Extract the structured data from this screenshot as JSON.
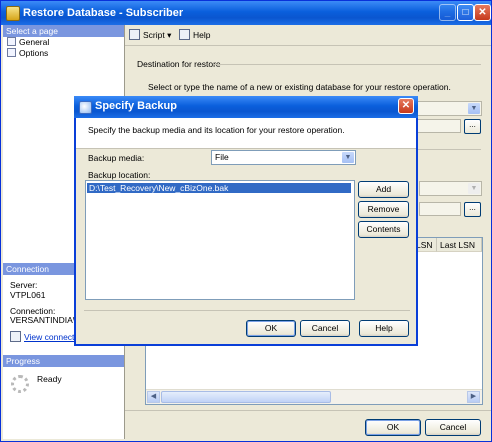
{
  "main_window": {
    "title": "Restore Database - Subscriber",
    "select_page_header": "Select a page",
    "pages": [
      "General",
      "Options"
    ],
    "toolbar": {
      "script_label": "Script",
      "help_label": "Help"
    },
    "destination_header": "Destination for restore",
    "destination_desc": "Select or type the name of a new or existing database for your restore operation.",
    "connection_header": "Connection",
    "server_label": "Server:",
    "server_value": "VTPL061",
    "connection_label": "Connection:",
    "connection_value": "VERSANTINDIA\\sr",
    "view_connection_label": "View connectio",
    "progress_header": "Progress",
    "progress_status": "Ready",
    "grid_columns": [
      "LSN",
      "Last LSN"
    ],
    "ok_label": "OK",
    "cancel_label": "Cancel"
  },
  "dialog": {
    "title": "Specify Backup",
    "description": "Specify the backup media and its location for your restore operation.",
    "media_label": "Backup media:",
    "media_value": "File",
    "location_label": "Backup location:",
    "location_items": [
      "D:\\Test_Recovery\\New_cBizOne.bak"
    ],
    "add_label": "Add",
    "remove_label": "Remove",
    "contents_label": "Contents",
    "ok_label": "OK",
    "cancel_label": "Cancel",
    "help_label": "Help"
  }
}
